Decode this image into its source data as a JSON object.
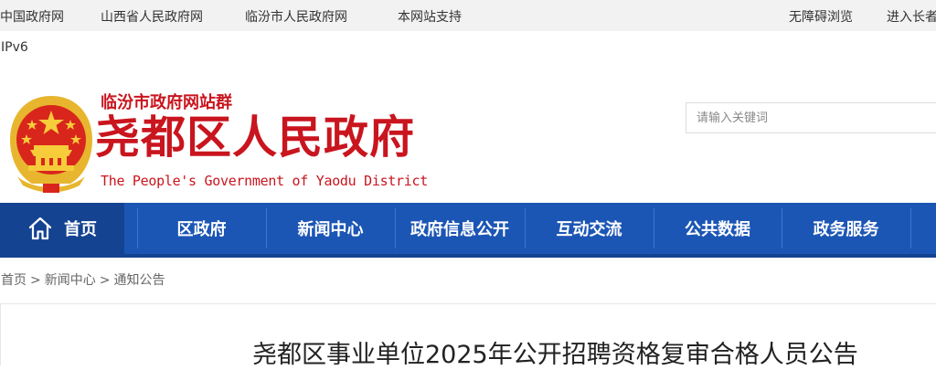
{
  "topbar": {
    "links": [
      "中国政府网",
      "山西省人民政府网",
      "临汾市人民政府网",
      "本网站支持"
    ],
    "accessibility": "无障碍浏览",
    "enter": "进入长者"
  },
  "ipv6": "IPv6",
  "header": {
    "site_group": "临汾市政府网站群",
    "title": "尧都区人民政府",
    "title_en": "The People's Government of Yaodu District",
    "emblem_icon": "national-emblem-icon"
  },
  "search": {
    "placeholder": "请输入关键词"
  },
  "nav": {
    "home": "首页",
    "items": [
      "区政府",
      "新闻中心",
      "政府信息公开",
      "互动交流",
      "公共数据",
      "政务服务"
    ]
  },
  "breadcrumb": {
    "items": [
      "首页",
      "新闻中心",
      "通知公告"
    ],
    "separator": ">"
  },
  "article": {
    "title": "尧都区事业单位2025年公开招聘资格复审合格人员公告"
  },
  "colors": {
    "brand_red": "#c9151e",
    "nav_blue": "#1c56b5",
    "nav_dark": "#144391"
  }
}
